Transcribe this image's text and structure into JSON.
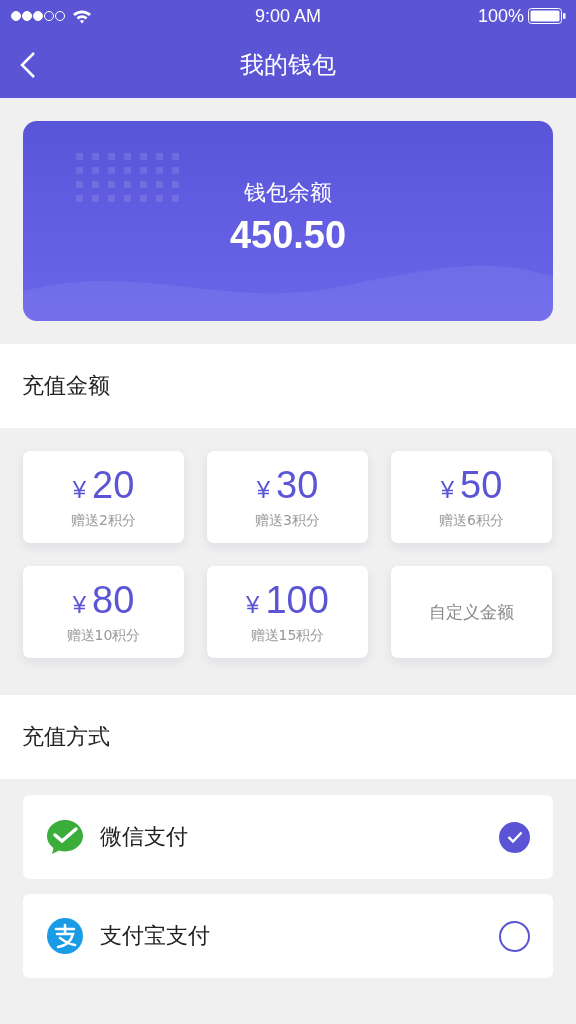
{
  "status_bar": {
    "time": "9:00 AM",
    "battery": "100%"
  },
  "nav": {
    "title": "我的钱包"
  },
  "wallet": {
    "label": "钱包余额",
    "balance": "450.50"
  },
  "recharge": {
    "title": "充值金额",
    "options": [
      {
        "kind": "amount",
        "currency": "¥",
        "value": "20",
        "bonus": "赠送2积分"
      },
      {
        "kind": "amount",
        "currency": "¥",
        "value": "30",
        "bonus": "赠送3积分"
      },
      {
        "kind": "amount",
        "currency": "¥",
        "value": "50",
        "bonus": "赠送6积分"
      },
      {
        "kind": "amount",
        "currency": "¥",
        "value": "80",
        "bonus": "赠送10积分"
      },
      {
        "kind": "amount",
        "currency": "¥",
        "value": "100",
        "bonus": "赠送15积分"
      },
      {
        "kind": "custom",
        "label": "自定义金额"
      }
    ]
  },
  "payment": {
    "title": "充值方式",
    "methods": [
      {
        "kind": "wechat",
        "name": "微信支付",
        "selected": true
      },
      {
        "kind": "alipay",
        "name": "支付宝支付",
        "selected": false
      }
    ]
  }
}
